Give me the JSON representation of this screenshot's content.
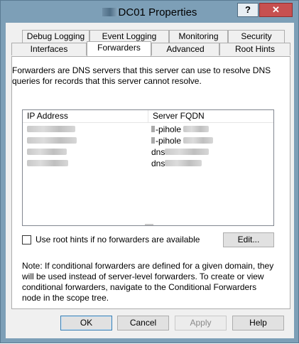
{
  "window": {
    "title": "DC01 Properties"
  },
  "titlebar": {
    "help_label": "?",
    "close_label": "✕"
  },
  "tabs_row1": [
    "Debug Logging",
    "Event Logging",
    "Monitoring",
    "Security"
  ],
  "tabs_row2": [
    "Interfaces",
    "Forwarders",
    "Advanced",
    "Root Hints"
  ],
  "active_tab": "Forwarders",
  "panel": {
    "description": "Forwarders are DNS servers that this server can use to resolve DNS queries for records that this server cannot resolve.",
    "columns": [
      "IP Address",
      "Server FQDN"
    ],
    "rows": [
      {
        "fqdn_prefix": "-pihole"
      },
      {
        "fqdn_prefix": "-pihole"
      },
      {
        "fqdn_prefix": "dns"
      },
      {
        "fqdn_prefix": "dns"
      }
    ],
    "checkbox_label": "Use root hints if no forwarders are available",
    "checkbox_checked": false,
    "edit_label": "Edit...",
    "note": "Note: If conditional forwarders are defined for a given domain, they will be used instead of server-level forwarders.  To create or view conditional forwarders, navigate to the Conditional Forwarders node in the scope tree."
  },
  "buttons": {
    "ok": "OK",
    "cancel": "Cancel",
    "apply": "Apply",
    "help": "Help"
  }
}
